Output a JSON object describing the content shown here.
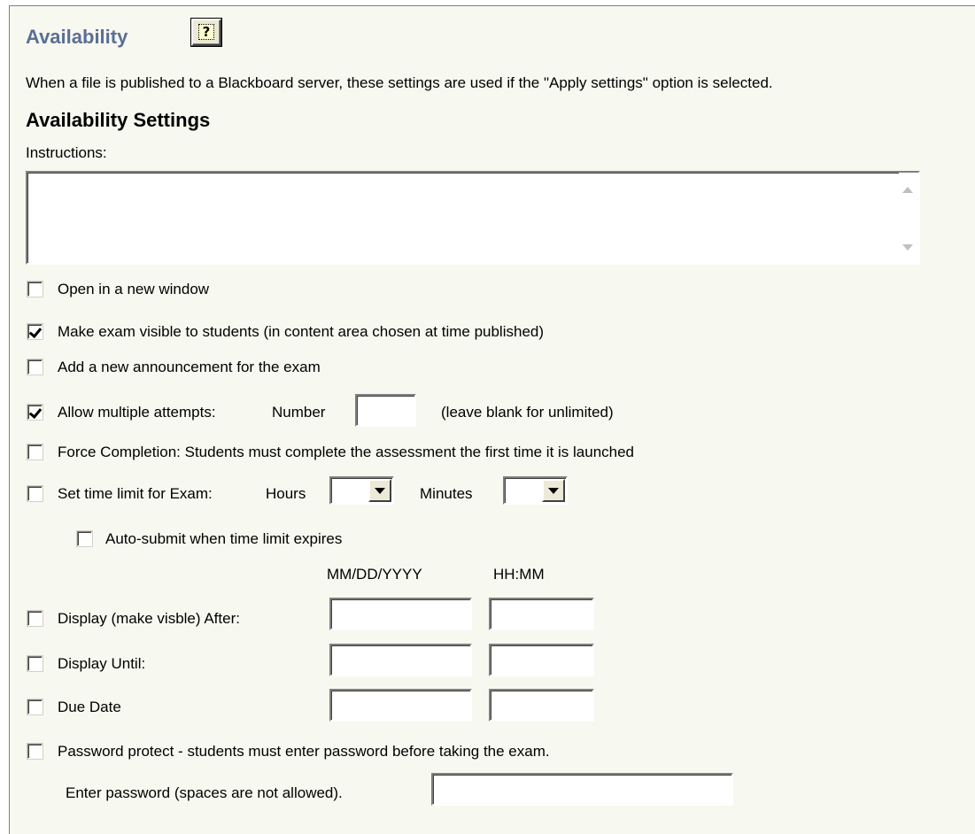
{
  "header": {
    "title": "Availability",
    "help_icon": "help-question-icon",
    "help_glyph": "?"
  },
  "description": "When a file is published to a Blackboard server, these settings are used if the \"Apply settings\" option is selected.",
  "section_title": "Availability Settings",
  "instructions": {
    "label": "Instructions:",
    "value": ""
  },
  "options": {
    "open_new_window": {
      "label": "Open in a new window",
      "checked": false
    },
    "make_visible": {
      "label": "Make exam visible to students (in content area chosen at time published)",
      "checked": true
    },
    "add_announcement": {
      "label": "Add a new announcement for the exam",
      "checked": false
    },
    "multiple_attempts": {
      "label": "Allow multiple attempts:",
      "checked": true,
      "number_label": "Number",
      "number_value": "",
      "hint": "(leave blank for unlimited)"
    },
    "force_completion": {
      "label": "Force Completion: Students must complete the assessment the first time it is launched",
      "checked": false
    },
    "time_limit": {
      "label": "Set time limit for Exam:",
      "checked": false,
      "hours_label": "Hours",
      "hours_value": "",
      "minutes_label": "Minutes",
      "minutes_value": ""
    },
    "auto_submit": {
      "label": "Auto-submit when time limit expires",
      "checked": false
    }
  },
  "date_headers": {
    "date": "MM/DD/YYYY",
    "time": "HH:MM"
  },
  "dates": {
    "display_after": {
      "label": "Display (make visble) After:",
      "checked": false,
      "date": "",
      "time": ""
    },
    "display_until": {
      "label": "Display Until:",
      "checked": false,
      "date": "",
      "time": ""
    },
    "due_date": {
      "label": "Due Date",
      "checked": false,
      "date": "",
      "time": ""
    }
  },
  "password": {
    "label": "Password protect - students must enter password before taking the exam.",
    "checked": false,
    "entry_label": "Enter password (spaces are not allowed).",
    "value": ""
  }
}
